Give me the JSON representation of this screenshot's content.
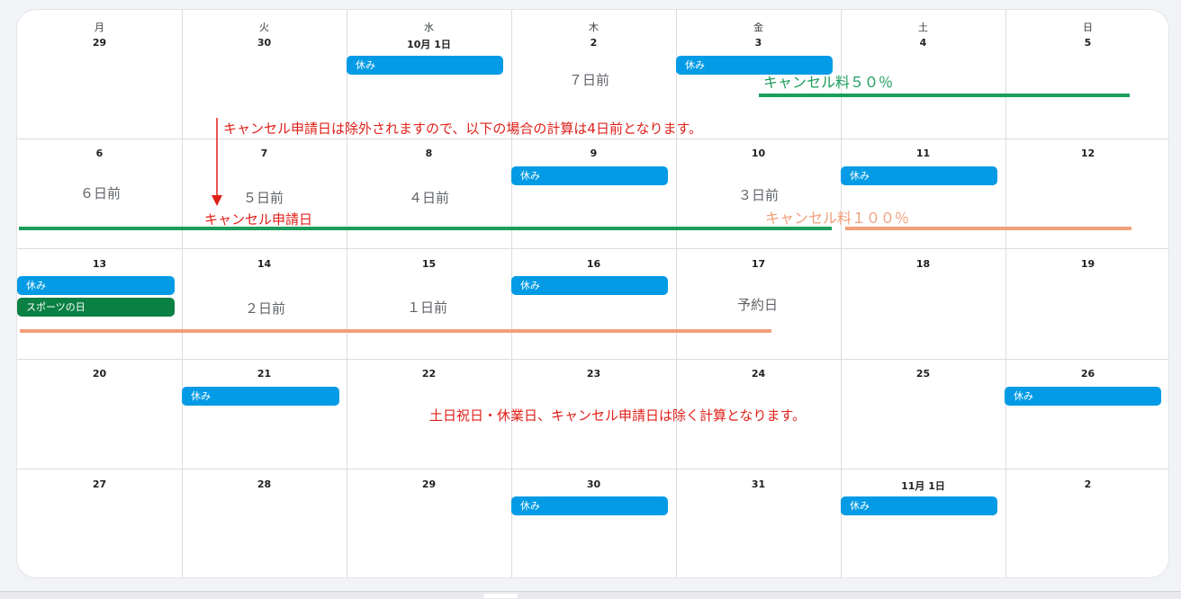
{
  "weekdays": [
    "月",
    "火",
    "水",
    "木",
    "金",
    "土",
    "日"
  ],
  "weeks": [
    [
      "29",
      "30",
      "10月 1日",
      "2",
      "3",
      "4",
      "5"
    ],
    [
      "6",
      "7",
      "8",
      "9",
      "10",
      "11",
      "12"
    ],
    [
      "13",
      "14",
      "15",
      "16",
      "17",
      "18",
      "19"
    ],
    [
      "20",
      "21",
      "22",
      "23",
      "24",
      "25",
      "26"
    ],
    [
      "27",
      "28",
      "29",
      "30",
      "31",
      "11月 1日",
      "2"
    ]
  ],
  "events": {
    "holiday_label": "休み",
    "sports_day_label": "スポーツの日"
  },
  "notes": {
    "days_7": "７日前",
    "days_6": "６日前",
    "days_5": "５日前",
    "days_4": "４日前",
    "days_3": "３日前",
    "days_2": "２日前",
    "days_1": "１日前",
    "reservation_day": "予約日"
  },
  "annotations": {
    "exclusion_note": "キャンセル申請日は除外されますので、以下の場合の計算は4日前となります。",
    "cancel_request_day": "キャンセル申請日",
    "fee_50": "キャンセル料５０％",
    "fee_100": "キャンセル料１００％",
    "calc_rule": "土日祝日・休業日、キャンセル申請日は除く計算となります。"
  },
  "colors": {
    "holiday_chip": "#039be5",
    "sports_day_chip": "#0b8043",
    "fee_50_line": "#1a9c5b",
    "fee_100_line": "#f0a07a",
    "annotation_red": "#e0201a",
    "gridline": "#dadce0"
  }
}
